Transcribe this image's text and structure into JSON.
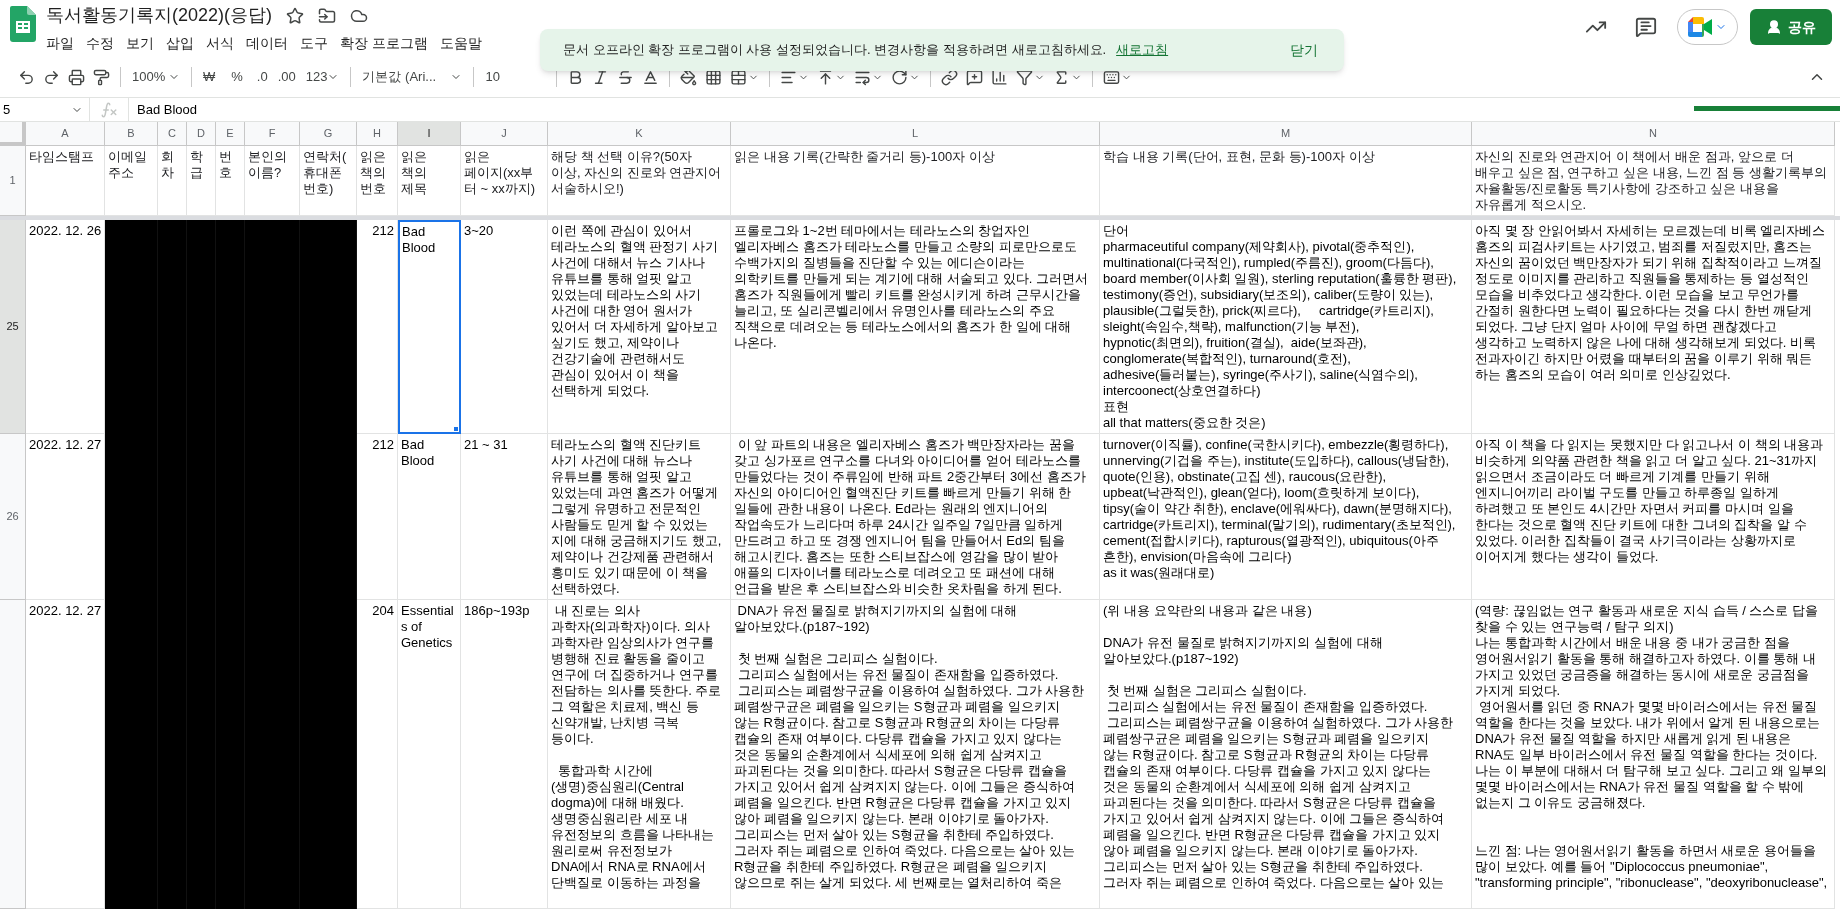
{
  "document": {
    "title": "독서활동기록지(2022)(응답)"
  },
  "menu": [
    "파일",
    "수정",
    "보기",
    "삽입",
    "서식",
    "데이터",
    "도구",
    "확장 프로그램",
    "도움말"
  ],
  "share_button": "공유",
  "toolbar": {
    "zoom": "100%",
    "currency": "₩",
    "percent": "%",
    "decrease_decimal": ".0",
    "increase_decimal": ".00",
    "number_format": "123",
    "font": "기본값 (Ari...",
    "font_size": "10"
  },
  "toast": {
    "message": "문서 오프라인 확장 프로그램이 사용 설정되었습니다. 변경사항을 적용하려면 새로고침하세요.",
    "link": "새로고침",
    "dismiss": "닫기"
  },
  "formula_bar": {
    "cell_ref": "5",
    "value": "Bad Blood"
  },
  "columns": [
    {
      "letter": "A",
      "selected": false
    },
    {
      "letter": "B",
      "selected": false
    },
    {
      "letter": "C",
      "selected": false
    },
    {
      "letter": "D",
      "selected": false
    },
    {
      "letter": "E",
      "selected": false
    },
    {
      "letter": "F",
      "selected": false
    },
    {
      "letter": "G",
      "selected": false
    },
    {
      "letter": "H",
      "selected": false
    },
    {
      "letter": "I",
      "selected": true
    },
    {
      "letter": "J",
      "selected": false
    },
    {
      "letter": "K",
      "selected": false
    },
    {
      "letter": "L",
      "selected": false
    },
    {
      "letter": "M",
      "selected": false
    },
    {
      "letter": "N",
      "selected": false
    }
  ],
  "header_row": {
    "number": "1",
    "cells": [
      {
        "kind": "text",
        "text": "타임스탬프"
      },
      {
        "kind": "text",
        "text": "이메일\n주소"
      },
      {
        "kind": "text",
        "text": "회\n차"
      },
      {
        "kind": "text",
        "text": "학\n급"
      },
      {
        "kind": "text",
        "text": "번\n호"
      },
      {
        "kind": "text",
        "text": "본인의\n이름?"
      },
      {
        "kind": "text",
        "text": "연락처(\n휴대폰\n번호)"
      },
      {
        "kind": "text",
        "text": "읽은\n책의\n번호"
      },
      {
        "kind": "text",
        "text": "읽은\n책의\n제목"
      },
      {
        "kind": "text",
        "text": "읽은\n페이지(xx부\n터 ~ xx까지)"
      },
      {
        "kind": "text",
        "text": "해당 책 선택 이유?(50자\n이상, 자신의 진로와 연관지어\n서술하시오!)"
      },
      {
        "kind": "text",
        "text": "읽은 내용 기록(간략한 줄거리 등)-100자 이상"
      },
      {
        "kind": "text",
        "text": "학습 내용 기록(단어, 표현, 문화 등)-100자 이상"
      },
      {
        "kind": "text",
        "text": "자신의 진로와 연관지어 이 책에서 배운 점과, 앞으로 더\n배우고 싶은 점, 연구하고 싶은 내용, 느낀 점 등 생활기록부의\n자율활동/진로활동 특기사항에 강조하고 싶은 내용을\n자유롭게 적으시오."
      }
    ]
  },
  "rows": [
    {
      "number": "25",
      "selected": true,
      "cells": [
        {
          "kind": "text",
          "text": "2022. 12. 26"
        },
        {
          "kind": "redacted"
        },
        {
          "kind": "redacted"
        },
        {
          "kind": "redacted"
        },
        {
          "kind": "redacted"
        },
        {
          "kind": "redacted"
        },
        {
          "kind": "redacted"
        },
        {
          "kind": "number",
          "text": "212"
        },
        {
          "kind": "text",
          "text": "Bad\nBlood"
        },
        {
          "kind": "text",
          "text": "3~20"
        },
        {
          "kind": "text",
          "text": "이런 쪽에 관심이 있어서\n테라노스의 혈액 판정기 사기\n사건에 대해서 뉴스 기사나\n유튜브를 통해 얼핏 알고\n있었는데 테라노스의 사기\n사건에 대한 영어 원서가\n있어서 더 자세하게 알아보고\n싶기도 했고, 제약이나\n건강기술에 관련해서도\n관심이 있어서 이 책을\n선택하게 되었다."
        },
        {
          "kind": "text",
          "text": "프롤로그와 1~2번 테마에서는 테라노스의 창업자인\n엘리자베스 홈즈가 테라노스를 만들고 소량의 피로만으로도\n수백가지의 질병들을 진단할 수 있는 에디슨이라는\n의학키트를 만들게 되는 계기에 대해 서술되고 있다. 그러면서\n홈즈가 직원들에게 빨리 키트를 완성시키게 하려 근무시간을\n늘리고, 또 실리콘벨리에서 유명인사를 테라노스의 주요\n직책으로 데려오는 등 테라노스에서의 홈즈가 한 일에 대해\n나온다."
        },
        {
          "kind": "text",
          "text": "단어\npharmaceutiful company(제약회사), pivotal(중추적인),\nmultinational(다국적인), rumpled(주름진), groom(다듬다),\nboard member(이사회 일원), sterling reputation(훌륭한 평판),\ntestimony(증언), subsidiary(보조의), caliber(도량이 있는),\nplausible(그럴듯한), prick(찌르다),     cartridge(카트리지),\nsleight(속임수,책략), malfunction(기능 부전),\nhypnotic(최면의), fruition(결실),  aide(보좌관),\nconglomerate(복합적인), turnaround(호전),\nadhesive(들러붙는), syringe(주사기), saline(식염수의),\nintercoonect(상호연결하다)\n표현\nall that matters(중요한 것은)"
        },
        {
          "kind": "text",
          "text": "아직 몇 장 안읽어봐서 자세히는 모르겠는데 비록 엘리자베스\n홈즈의 피검사키트는 사기였고, 범죄를 저질렀지만, 홈즈는\n자신의 꿈이었던 백만장자가 되기 위해 집착적이라고 느껴질\n정도로 이미지를 관리하고 직원들을 통제하는 등 열성적인\n모습을 비추었다고 생각한다. 이런 모습을 보고 무언가를\n간절히 원한다면 노력이 필요하다는 것을 다시 한번 깨닫게\n되었다. 그냥 단지 얼마 사이에 무얼 하면 괜찮겠다고\n생각하고 노력하지 않은 나에 대해 생각해보게 되었다. 비록\n전과자이긴 하지만 어렸을 때부터의 꿈을 이루기 위해 뭐든\n하는 홈즈의 모습이 여러 의미로 인상깊었다."
        }
      ]
    },
    {
      "number": "26",
      "selected": false,
      "cells": [
        {
          "kind": "text",
          "text": "2022. 12. 27"
        },
        {
          "kind": "redacted"
        },
        {
          "kind": "redacted"
        },
        {
          "kind": "redacted"
        },
        {
          "kind": "redacted"
        },
        {
          "kind": "redacted"
        },
        {
          "kind": "redacted"
        },
        {
          "kind": "number",
          "text": "212"
        },
        {
          "kind": "text",
          "text": "Bad\nBlood"
        },
        {
          "kind": "text",
          "text": "21 ~ 31"
        },
        {
          "kind": "text",
          "text": "테라노스의 혈액 진단키트\n사기 사건에 대해 뉴스나\n유튜브를 통해 얼핏 알고\n있었는데 과연 홈즈가 어떻게\n그렇게 유명하고 전문적인\n사람들도 믿게 할 수 있었는\n지에 대해 궁금해지기도 했고,\n제약이나 건강제품 관련해서\n흥미도 있기 때문에 이 책을\n선택하였다."
        },
        {
          "kind": "text",
          "text": " 이 앞 파트의 내용은 엘리자베스 홈즈가 백만장자라는 꿈을\n갖고 싱가포르 연구소를 다녀와 아이디어를 얻어 테라노스를\n만들었다는 것이 주류임에 반해 파트 2중간부터 3에선 홈즈가\n자신의 아이디어인 혈액진단 키트를 빠르게 만들기 위해 한\n일들에 관한 내용이 나온다. Ed라는 원래의 엔지니어의\n작업속도가 느리다며 하루 24시간 일주일 7일만큼 일하게\n만드려고 하고 또 경쟁 엔지니어 팀을 만들어서 Ed의 팀을\n해고시킨다. 홈즈는 또한 스티브잡스에 영감을 많이 받아\n애플의 디자이너를 테라노스로 데려오고 또 패션에 대해\n언급을 받은 후 스티브잡스와 비슷한 옷차림을 하게 된다."
        },
        {
          "kind": "text",
          "text": "turnover(이직률), confine(국한시키다), embezzle(횡령하다),\nunnerving(기겁을 주는), institute(도입하다), callous(냉담한),\nquote(인용), obstinate(고집 센), raucous(요란한),\nupbeat(낙관적인), glean(얻다), loom(흐릿하게 보이다),\ntipsy(술이 약간 취한), enclave(에워싸다), dawn(분명해지다),\ncartridge(카트리지), terminal(말기의), rudimentary(초보적인),\ncement(접합시키다), rapturous(열광적인), ubiquitous(아주\n흔한), envision(마음속에 그리다)\nas it was(원래대로)"
        },
        {
          "kind": "text",
          "text": "아직 이 책을 다 읽지는 못했지만 다 읽고나서 이 책의 내용과\n비슷하게 의약품 관련한 책을 읽고 더 알고 싶다. 21~31까지\n읽으면서 조금이라도 더 빠르게 기계를 만들기 위해\n엔지니어끼리 라이벌 구도를 만들고 하루종일 일하게\n하려했고 또 본인도 4시간만 자면서 커피를 마시며 일을\n한다는 것으로 혈액 진단 키트에 대한 그녀의 집착을 알 수\n있었다. 이러한 집착들이 결국 사기극이라는 상황까지로\n이어지게 했다는 생각이 들었다."
        }
      ]
    },
    {
      "selected": false,
      "cells": [
        {
          "kind": "text",
          "text": "2022. 12. 27"
        },
        {
          "kind": "redacted"
        },
        {
          "kind": "redacted"
        },
        {
          "kind": "redacted"
        },
        {
          "kind": "redacted"
        },
        {
          "kind": "redacted"
        },
        {
          "kind": "redacted"
        },
        {
          "kind": "number",
          "text": "204"
        },
        {
          "kind": "text",
          "text": "Essential\ns of\nGenetics"
        },
        {
          "kind": "text",
          "text": "186p~193p"
        },
        {
          "kind": "text",
          "text": " 내 진로는 의사\n과학자(의과학자)이다. 의사\n과학자란 임상의사가 연구를\n병행해 진료 활동을 줄이고\n연구에 더 집중하거나 연구를\n전담하는 의사를 뜻한다. 주로\n그 역할은 치료제, 백신 등\n신약개발, 난치병 극복\n등이다.\n\n  통합과학 시간에\n(생명)중심원리(Central\ndogma)에 대해 배웠다.\n생명중심원리란 세포 내\n유전정보의 흐름을 나타내는\n원리로써 유전정보가\nDNA에서 RNA로 RNA에서\n단백질로 이동하는 과정을"
        },
        {
          "kind": "text",
          "text": " DNA가 유전 물질로 밝혀지기까지의 실험에 대해\n알아보았다.(p187~192)\n\n 첫 번째 실험은 그리피스 실험이다.\n 그리피스 실험에서는 유전 물질이 존재함을 입증하였다.\n 그리피스는 폐렴쌍구균을 이용하여 실험하였다. 그가 사용한\n폐렴쌍구균은 폐렴을 일으키는 S형균과 폐렴을 일으키지\n않는 R형균이다. 참고로 S형균과 R형균의 차이는 다당류\n캡슐의 존재 여부이다. 다당류 캡슐을 가지고 있지 않다는\n것은 동물의 순환계에서 식세포에 의해 쉽게 삼켜지고\n파괴된다는 것을 의미한다. 따라서 S형균은 다당류 캡슐을\n가지고 있어서 쉽게 삼켜지지 않는다. 이에 그들은 증식하여\n폐렴을 일으킨다. 반면 R형균은 다당류 캡슐을 가지고 있지\n않아 폐렴을 일으키지 않는다. 본래 이야기로 돌아가자.\n그리피스는 먼저 살아 있는 S형균을 취한테 주입하였다.\n그러자 쥐는 폐렴으로 인하여 죽었다. 다음으로는 살아 있는\nR형균을 취한테 주입하였다. R형균은 폐렴을 일으키지\n않으므로 쥐는 살게 되었다. 세 번째로는 열처리하여 죽은"
        },
        {
          "kind": "text",
          "text": "(위 내용 요약란의 내용과 같은 내용)\n\nDNA가 유전 물질로 밝혀지기까지의 실험에 대해\n알아보았다.(p187~192)\n\n 첫 번째 실험은 그리피스 실험이다.\n 그리피스 실험에서는 유전 물질이 존재함을 입증하였다.\n 그리피스는 폐렴쌍구균을 이용하여 실험하였다. 그가 사용한\n폐렴쌍구균은 폐렴을 일으키는 S형균과 폐렴을 일으키지\n않는 R형균이다. 참고로 S형균과 R형균의 차이는 다당류\n캡슐의 존재 여부이다. 다당류 캡슐을 가지고 있지 않다는\n것은 동물의 순환계에서 식세포에 의해 쉽게 삼켜지고\n파괴된다는 것을 의미한다. 따라서 S형균은 다당류 캡슐을\n가지고 있어서 쉽게 삼켜지지 않는다. 이에 그들은 증식하여\n폐렴을 일으킨다. 반면 R형균은 다당류 캡슐을 가지고 있지\n않아 폐렴을 일으키지 않는다. 본래 이야기로 돌아가자.\n그리피스는 먼저 살아 있는 S형균을 취한테 주입하였다.\n그러자 쥐는 폐렴으로 인하여 죽었다. 다음으로는 살아 있는"
        },
        {
          "kind": "text",
          "text": "(역량: 끊임없는 연구 활동과 새로운 지식 습득 / 스스로 답을\n찾을 수 있는 연구능력 / 탐구 의지)\n나는 통합과학 시간에서 배운 내용 중 내가 궁금한 점을\n영어원서읽기 활동을 통해 해결하고자 하였다. 이를 통해 내\n가지고 있었던 궁금증을 해결하는 동시에 새로운 궁금점을\n가지게 되었다.\n 영어원서를 읽던 중 RNA가 몇몇 바이러스에서는 유전 물질\n역할을 한다는 것을 보았다. 내가 위에서 알게 된 내용으로는\nDNA가 유전 물질 역할을 하지만 새롭게 읽게 된 내용은\nRNA도 일부 바이러스에서 유전 물질 역할을 한다는 것이다.\n나는 이 부분에 대해서 더 탐구해 보고 싶다. 그리고 왜 일부의\n몇몇 바이러스에서는 RNA가 유전 물질 역할을 할 수 밖에\n없는지 그 이유도 궁금해졌다.\n\n\n느낀 점: 나는 영어원서읽기 활동을 하면서 새로운 용어들을\n많이 보았다. 예를 들어 \"Diplococcus pneumoniae\",\n\"transforming principle\", \"ribonuclease\", \"deoxyribonuclease\","
        }
      ]
    }
  ]
}
